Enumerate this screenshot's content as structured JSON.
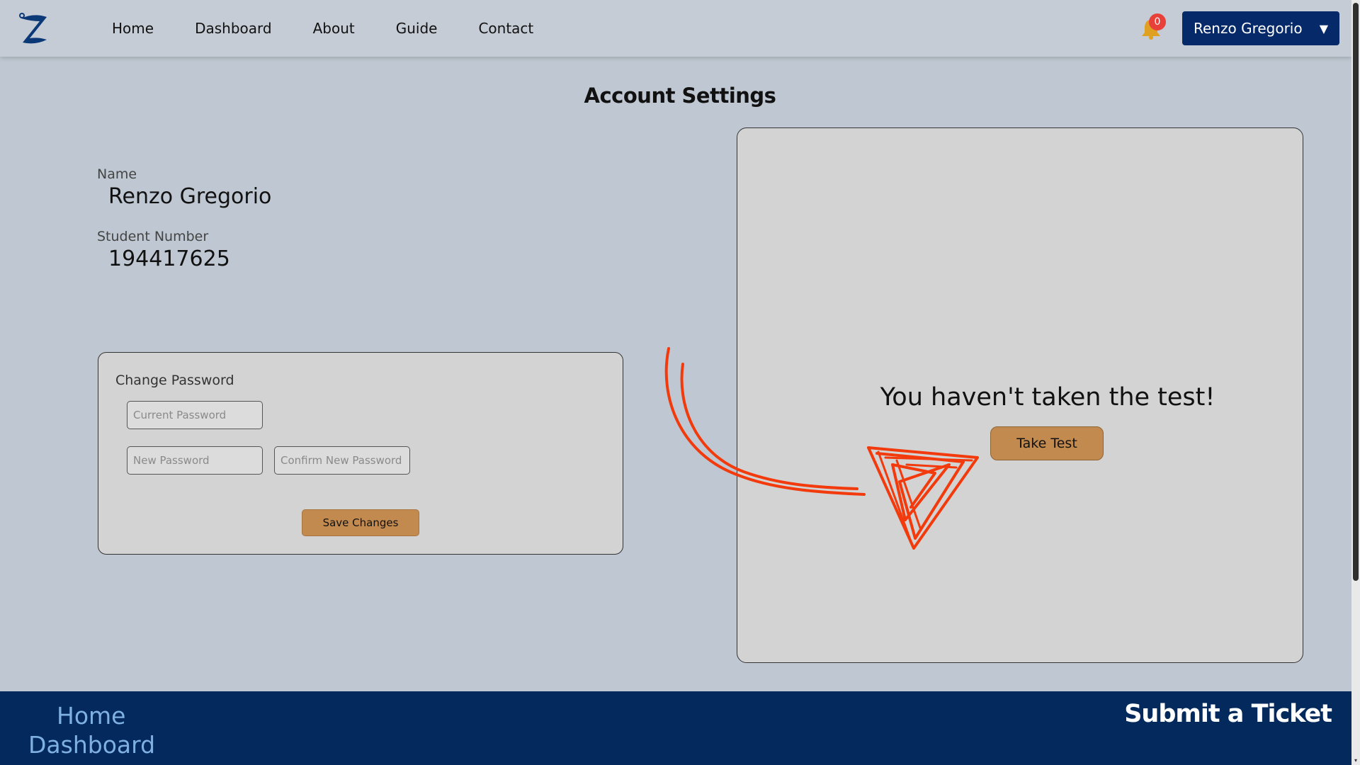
{
  "navbar": {
    "logo_icon": "z-logo-icon",
    "links": [
      "Home",
      "Dashboard",
      "About",
      "Guide",
      "Contact"
    ],
    "notification_count": "0",
    "user_name": "Renzo Gregorio",
    "user_caret": "▼"
  },
  "page": {
    "title": "Account Settings"
  },
  "profile": {
    "name_label": "Name",
    "name_value": "Renzo Gregorio",
    "student_number_label": "Student Number",
    "student_number_value": "194417625"
  },
  "change_password": {
    "title": "Change Password",
    "current_placeholder": "Current Password",
    "new_placeholder": "New Password",
    "confirm_placeholder": "Confirm New Password",
    "save_label": "Save Changes"
  },
  "test_panel": {
    "message": "You haven't taken the test!",
    "button_label": "Take Test"
  },
  "footer": {
    "links": [
      "Home",
      "Dashboard"
    ],
    "ticket_label": "Submit a Ticket"
  },
  "colors": {
    "page_bg": "#bfc8d2",
    "navbar_bg": "#c5ccd5",
    "accent_navy": "#06296a",
    "button_orange": "#c28a4f",
    "footer_bg": "#042a5d",
    "annotation_red": "#f23a0c"
  }
}
